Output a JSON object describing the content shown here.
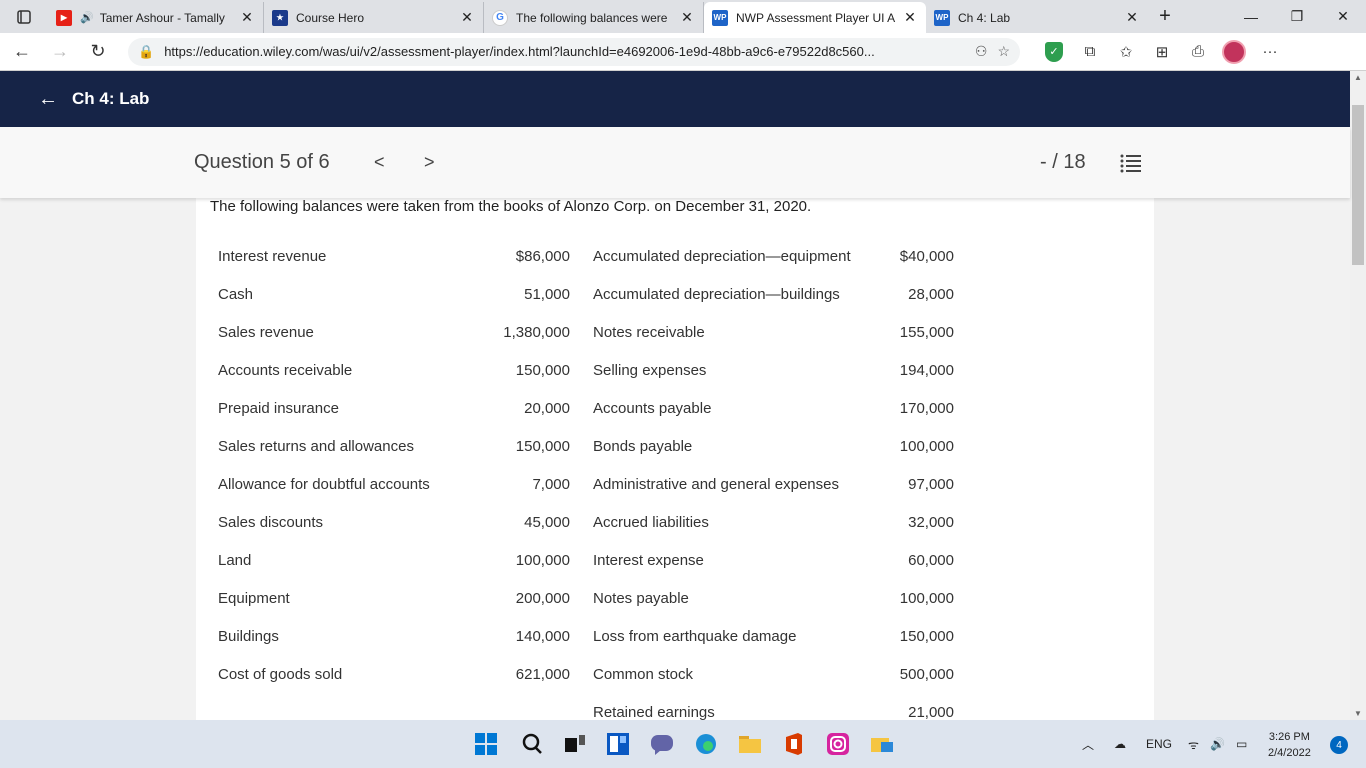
{
  "browser": {
    "tabs": [
      {
        "title": "Tamer Ashour - Tamally",
        "favicon": "youtube-icon",
        "audio": true
      },
      {
        "title": "Course Hero",
        "favicon": "course-hero-icon"
      },
      {
        "title": "The following balances were",
        "favicon": "google-icon"
      },
      {
        "title": "NWP Assessment Player UI A",
        "favicon": "wp-icon",
        "active": true
      },
      {
        "title": "Ch 4: Lab",
        "favicon": "wp-icon"
      }
    ],
    "url": "https://education.wiley.com/was/ui/v2/assessment-player/index.html?launchId=e4692006-1e9d-48bb-a9c6-e79522d8c560...",
    "more_label": "···"
  },
  "app": {
    "header_title": "Ch 4: Lab",
    "question_label": "Question 5 of 6",
    "score": "- / 18"
  },
  "question": {
    "intro": "The following balances were taken from the books of Alonzo Corp. on December 31, 2020.",
    "rows": [
      {
        "l_label": "Interest revenue",
        "l_value": "$86,000",
        "r_label": "Accumulated depreciation—equipment",
        "r_value": "$40,000"
      },
      {
        "l_label": "Cash",
        "l_value": "51,000",
        "r_label": "Accumulated depreciation—buildings",
        "r_value": "28,000"
      },
      {
        "l_label": "Sales revenue",
        "l_value": "1,380,000",
        "r_label": "Notes receivable",
        "r_value": "155,000"
      },
      {
        "l_label": "Accounts receivable",
        "l_value": "150,000",
        "r_label": "Selling expenses",
        "r_value": "194,000"
      },
      {
        "l_label": "Prepaid insurance",
        "l_value": "20,000",
        "r_label": "Accounts payable",
        "r_value": "170,000"
      },
      {
        "l_label": "Sales returns and allowances",
        "l_value": "150,000",
        "r_label": "Bonds payable",
        "r_value": "100,000"
      },
      {
        "l_label": "Allowance for doubtful accounts",
        "l_value": "7,000",
        "r_label": "Administrative and general expenses",
        "r_value": "97,000"
      },
      {
        "l_label": "Sales discounts",
        "l_value": "45,000",
        "r_label": "Accrued liabilities",
        "r_value": "32,000"
      },
      {
        "l_label": "Land",
        "l_value": "100,000",
        "r_label": "Interest expense",
        "r_value": "60,000"
      },
      {
        "l_label": "Equipment",
        "l_value": "200,000",
        "r_label": "Notes payable",
        "r_value": "100,000"
      },
      {
        "l_label": "Buildings",
        "l_value": "140,000",
        "r_label": "Loss from earthquake damage",
        "r_value": "150,000"
      },
      {
        "l_label": "Cost of goods sold",
        "l_value": "621,000",
        "r_label": "Common stock",
        "r_value": "500,000"
      },
      {
        "l_label": "",
        "l_value": "",
        "r_label": "Retained earnings",
        "r_value": "21,000"
      }
    ]
  },
  "taskbar": {
    "language": "ENG",
    "time": "3:26 PM",
    "date": "2/4/2022",
    "notifications": "4"
  },
  "colors": {
    "header_bg": "#162447",
    "active_tab": "#ffffff",
    "taskbar_bg": "#dde4ee"
  }
}
